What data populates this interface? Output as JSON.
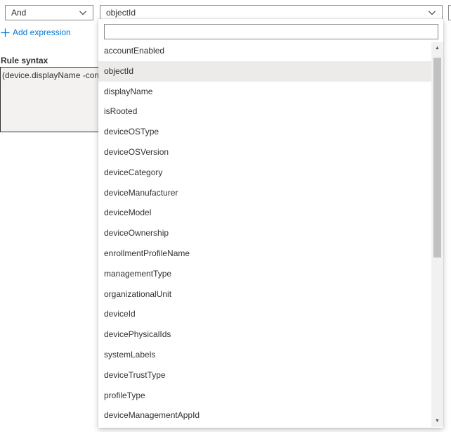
{
  "combinator": {
    "value": "And"
  },
  "property_select": {
    "value": "objectId"
  },
  "add_expression": {
    "label": "Add expression"
  },
  "rule_syntax": {
    "label": "Rule syntax",
    "text": "(device.displayName -contains"
  },
  "dropdown": {
    "filter_value": "",
    "selected": "objectId",
    "options": [
      "accountEnabled",
      "objectId",
      "displayName",
      "isRooted",
      "deviceOSType",
      "deviceOSVersion",
      "deviceCategory",
      "deviceManufacturer",
      "deviceModel",
      "deviceOwnership",
      "enrollmentProfileName",
      "managementType",
      "organizationalUnit",
      "deviceId",
      "devicePhysicalIds",
      "systemLabels",
      "deviceTrustType",
      "profileType",
      "deviceManagementAppId"
    ]
  },
  "colors": {
    "accent": "#0078d4",
    "selected_bg": "#edebe9",
    "text": "#323130"
  }
}
